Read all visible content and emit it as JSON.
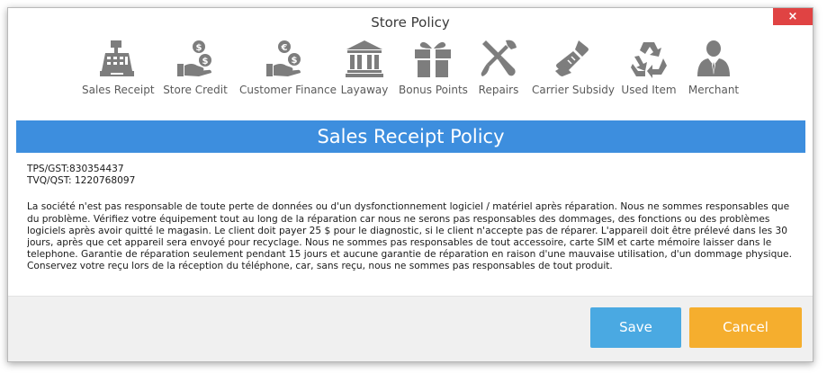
{
  "window": {
    "title": "Store Policy",
    "close_glyph": "×"
  },
  "toolbar": {
    "items": [
      {
        "label": "Sales Receipt",
        "icon": "cash-register-icon"
      },
      {
        "label": "Store Credit",
        "icon": "hand-money-icon"
      },
      {
        "label": "Customer Finance",
        "icon": "hand-euro-money-icon"
      },
      {
        "label": "Layaway",
        "icon": "bank-icon"
      },
      {
        "label": "Bonus Points",
        "icon": "gift-icon"
      },
      {
        "label": "Repairs",
        "icon": "tools-icon"
      },
      {
        "label": "Carrier Subsidy",
        "icon": "phone-icon"
      },
      {
        "label": "Used Item",
        "icon": "recycle-icon"
      },
      {
        "label": "Merchant",
        "icon": "merchant-icon"
      }
    ]
  },
  "policy": {
    "heading": "Sales Receipt Policy",
    "tps_line": "TPS/GST:830354437",
    "tvq_line": "TVQ/QST: 1220768097",
    "body": "La société n'est pas responsable de toute perte de données ou d'un dysfonctionnement logiciel / matériel après réparation. Nous ne sommes responsables que du problème. Vérifiez votre équipement tout au long de la réparation car nous ne serons pas responsables des dommages, des fonctions ou des problèmes logiciels après avoir quitté le magasin. Le client doit payer 25 $ pour le diagnostic, si le client n'accepte pas de réparer. L'appareil doit être prélevé dans les 30 jours, après que cet appareil sera envoyé pour recyclage. Nous ne sommes pas responsables de tout accessoire, carte SIM et carte mémoire laisser dans le telephone. Garantie de réparation seulement pendant 15 jours et aucune garantie de réparation en raison d'une mauvaise utilisation, d'un dommage physique. Conservez votre reçu lors de la réception du téléphone, car, sans reçu, nous ne sommes pas responsables de tout produit."
  },
  "footer": {
    "save_label": "Save",
    "cancel_label": "Cancel"
  },
  "colors": {
    "banner": "#3d8ede",
    "save": "#4aa9e2",
    "cancel": "#f5ae2e",
    "close": "#e04343",
    "icon": "#7d7d7d"
  }
}
